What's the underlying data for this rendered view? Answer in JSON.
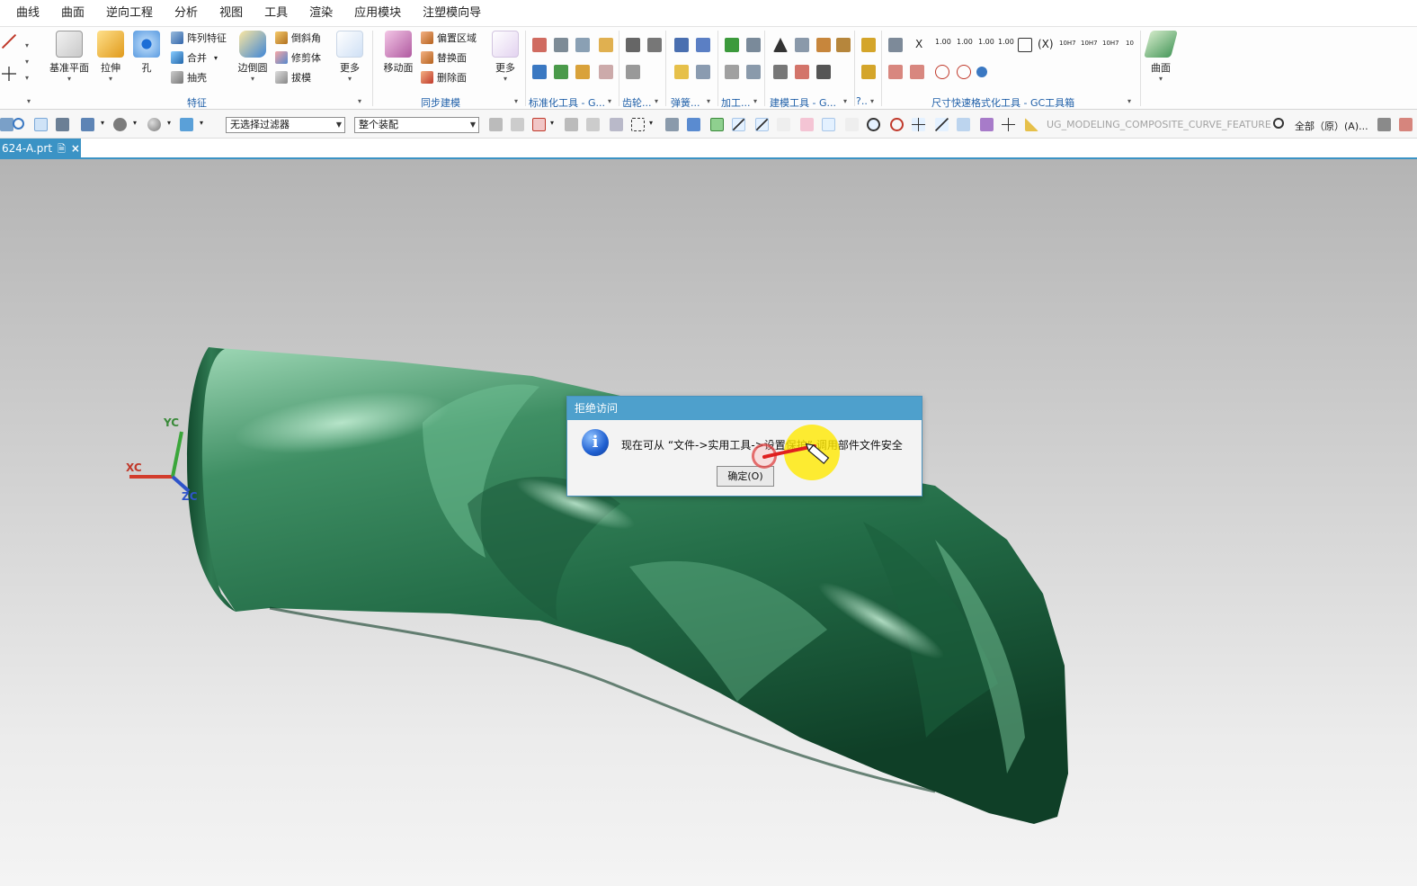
{
  "menu": [
    "曲线",
    "曲面",
    "逆向工程",
    "分析",
    "视图",
    "工具",
    "渲染",
    "应用模块",
    "注塑模向导"
  ],
  "ribbon": {
    "feature": {
      "datum_plane": "基准平面",
      "extrude": "拉伸",
      "hole": "孔",
      "pattern_feature": "阵列特征",
      "unite": "合并",
      "shell": "抽壳",
      "edge_blend": "边倒圆",
      "chamfer": "倒斜角",
      "trim_body": "修剪体",
      "draft": "拔模",
      "more": "更多",
      "group_label": "特征"
    },
    "sync": {
      "move_face": "移动面",
      "offset_region": "偏置区域",
      "replace_face": "替换面",
      "delete_face": "删除面",
      "more": "更多",
      "group_label": "同步建模"
    },
    "groups": {
      "std_tools": "标准化工具 - G...",
      "gear": "齿轮...",
      "spring": "弹簧...",
      "machining": "加工...",
      "modeling_tools": "建模工具 - G...",
      "misc": "?..",
      "dim_format": "尺寸快速格式化工具 - GC工具箱"
    },
    "dim_labels": [
      "X",
      "1.00",
      "1.00",
      "1.00",
      "1.00",
      "(X)",
      "10H7",
      "10H7",
      "10H7",
      "10"
    ],
    "surface": "曲面"
  },
  "toolbar": {
    "filter_select": "无选择过滤器",
    "assembly_select": "整个装配",
    "feature_text": "UG_MODELING_COMPOSITE_CURVE_FEATURE",
    "scope_text": "全部（原）(A)..."
  },
  "tab": {
    "name": "624-A.prt",
    "doc_icon": "🗎",
    "close": "×"
  },
  "triad": {
    "xc": "XC",
    "yc": "YC",
    "zc": "ZC"
  },
  "dialog": {
    "title": "拒绝访问",
    "icon": "i",
    "message": "现在可从 “文件->实用工具->设置保护” 调用部件文件安全",
    "ok_button": "确定(O)"
  },
  "colors": {
    "accent": "#3b93c5",
    "model_green": "#2f7a52",
    "dialog_title": "#4ea0cc"
  }
}
